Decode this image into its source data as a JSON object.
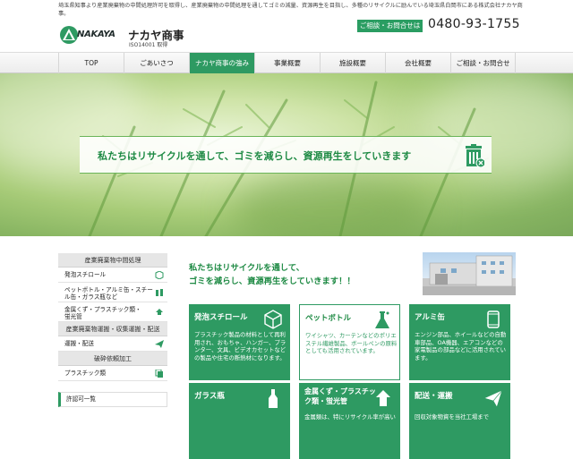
{
  "header": {
    "description": "埼玉県知事より産業廃棄物の中間処理許可を取得し、産業廃棄物の中間処理を通してゴミの減量、資源再生を目指し、多種のリサイクルに励んでいる埼玉県白岡市にある株式会社ナカヤ商事。",
    "logo_en": "NAKAYA",
    "logo_jp": "ナカヤ商事",
    "iso": "ISO14001 取得",
    "contact_label": "ご相談・お問合せは",
    "phone": "0480-93-1755"
  },
  "nav": {
    "items": [
      "TOP",
      "ごあいさつ",
      "ナカヤ商事の強み",
      "事業概要",
      "施設概要",
      "会社概要",
      "ご相談・お問合せ"
    ],
    "active_index": 2
  },
  "hero": {
    "tagline": "私たちはリサイクルを通して、ゴミを減らし、資源再生をしていきます",
    "icon": "trash-bin-icon"
  },
  "sidebar": {
    "sections": [
      {
        "title": "産業廃棄物中間処理",
        "items": [
          "発泡スチロール",
          "ペットボトル・アルミ缶・スチール缶・ガラス瓶など",
          "金属くず・プラスチック類・蛍光管"
        ]
      },
      {
        "title": "産業廃棄物運搬・収集運搬・配送",
        "items": [
          "運搬・配送"
        ]
      },
      {
        "title": "破砕依頼加工",
        "items": [
          "プラスチック類"
        ]
      }
    ],
    "permit_link": "許認可一覧"
  },
  "main": {
    "heading_line1": "私たちはリサイクルを通して、",
    "heading_line2": "ゴミを減らし、資源再生をしていきます！！",
    "cards": [
      {
        "title": "発泡スチロール",
        "desc": "プラスチック製品の材料として再利用され、おもちゃ、ハンガー、プランター、文具、ビデオカセットなどの製品や住宅の断熱材になります。",
        "icon": "cube-icon",
        "style": "green"
      },
      {
        "title": "ペットボトル",
        "desc": "ワイシャツ、カーテンなどのポリエステル繊維製品、ボールペンの原料としても活用されています。",
        "icon": "flask-icon",
        "style": "light"
      },
      {
        "title": "アルミ缶",
        "desc": "エンジン部品、ホイールなどの自動車部品、OA機器、エアコンなどの家電製品の部品などに活用されています。",
        "icon": "can-icon",
        "style": "green"
      },
      {
        "title": "ガラス瓶",
        "desc": "",
        "icon": "bottle-icon",
        "style": "green"
      },
      {
        "title": "金属くず・プラスチック類・蛍光管",
        "desc": "金属類は、特にリサイクル率が高い",
        "icon": "recycle-icon",
        "style": "green"
      },
      {
        "title": "配送・運搬",
        "desc": "回収対象物資を当社工場まで",
        "icon": "paper-plane-icon",
        "style": "green"
      }
    ]
  }
}
